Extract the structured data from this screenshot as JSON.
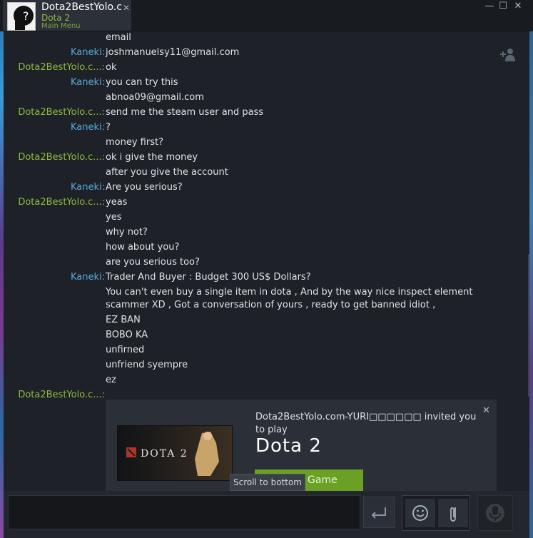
{
  "window": {
    "tab_name": "Dota2BestYolo.c",
    "tab_game": "Dota 2",
    "tab_menu": "Main Menu",
    "tab_close": "✕",
    "minimize": "—",
    "maximize": "☐",
    "close": "✕"
  },
  "chat": {
    "messages": [
      {
        "sender": "",
        "sender_class": "",
        "text": "email"
      },
      {
        "sender": "Kaneki:",
        "sender_class": "kaneki",
        "text": "joshmanuelsy11@gmail.com"
      },
      {
        "sender": "Dota2BestYolo.c...:",
        "sender_class": "dota",
        "text": "ok"
      },
      {
        "sender": "Kaneki:",
        "sender_class": "kaneki",
        "text": "you can try this"
      },
      {
        "sender": "",
        "sender_class": "",
        "text": "abnoa09@gmail.com"
      },
      {
        "sender": "Dota2BestYolo.c...:",
        "sender_class": "dota",
        "text": "send me the steam user and pass"
      },
      {
        "sender": "Kaneki:",
        "sender_class": "kaneki",
        "text": "?"
      },
      {
        "sender": "",
        "sender_class": "",
        "text": "money first?"
      },
      {
        "sender": "Dota2BestYolo.c...:",
        "sender_class": "dota",
        "text": "ok i give the money"
      },
      {
        "sender": "",
        "sender_class": "",
        "text": "after you give the account"
      },
      {
        "sender": "Kaneki:",
        "sender_class": "kaneki",
        "text": "Are you serious?"
      },
      {
        "sender": "Dota2BestYolo.c...:",
        "sender_class": "dota",
        "text": "yeas"
      },
      {
        "sender": "",
        "sender_class": "",
        "text": "yes"
      },
      {
        "sender": "",
        "sender_class": "",
        "text": "why not?"
      },
      {
        "sender": "",
        "sender_class": "",
        "text": "how about you?"
      },
      {
        "sender": "",
        "sender_class": "",
        "text": "are you serious too?"
      },
      {
        "sender": "Kaneki:",
        "sender_class": "kaneki",
        "text": "Trader And Buyer : Budget 300 US$ Dollars?"
      },
      {
        "sender": "",
        "sender_class": "",
        "text": "You can't even buy a single item in dota , And by the way nice inspect element scammer XD , Got a conversation of yours , ready to get banned idiot ,"
      },
      {
        "sender": "",
        "sender_class": "",
        "text": "EZ BAN"
      },
      {
        "sender": "",
        "sender_class": "",
        "text": "BOBO KA"
      },
      {
        "sender": "",
        "sender_class": "",
        "text": "unfirned"
      },
      {
        "sender": "",
        "sender_class": "",
        "text": "unfriend syempre"
      },
      {
        "sender": "",
        "sender_class": "",
        "text": "ez"
      },
      {
        "sender": "Dota2BestYolo.c...:",
        "sender_class": "dota",
        "text": ""
      }
    ]
  },
  "invite": {
    "text": "Dota2BestYolo.com-YURI□□□□□□ invited you to play",
    "game": "Dota 2",
    "art_label": "DOTA 2",
    "button": "Game",
    "close": "✕"
  },
  "tooltip": "Scroll to bottom",
  "colors": {
    "kaneki": "#5aa9d8",
    "dota": "#90ba3c",
    "accent_green": "#6aa023"
  },
  "icons": [
    "add-friend-icon",
    "send-icon",
    "emoji-icon",
    "attach-icon",
    "voice-icon",
    "close-icon"
  ]
}
